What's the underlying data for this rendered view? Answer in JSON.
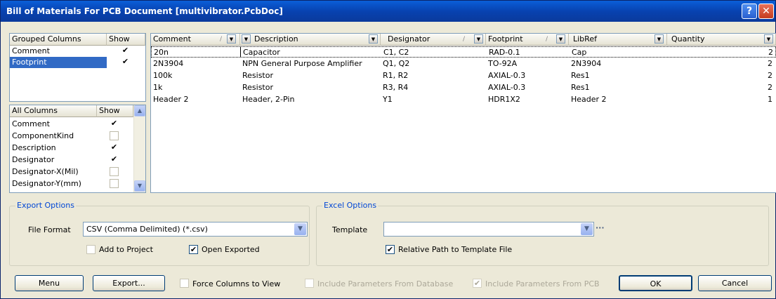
{
  "window": {
    "title": "Bill of Materials For PCB Document [multivibrator.PcbDoc]",
    "help_glyph": "?",
    "close_glyph": "✕"
  },
  "grouped": {
    "header_col": "Grouped Columns",
    "header_show": "Show",
    "items": [
      {
        "label": "Comment",
        "show": "✔"
      },
      {
        "label": "Footprint",
        "show": "✔"
      }
    ]
  },
  "all_columns": {
    "header_col": "All Columns",
    "header_show": "Show",
    "items": [
      {
        "label": "Comment",
        "show": "✔"
      },
      {
        "label": "ComponentKind",
        "show": ""
      },
      {
        "label": "Description",
        "show": "✔"
      },
      {
        "label": "Designator",
        "show": "✔"
      },
      {
        "label": "Designator-X(Mil)",
        "show": ""
      },
      {
        "label": "Designator-Y(mm)",
        "show": ""
      }
    ],
    "scroll_up": "▲",
    "scroll_down": "▼"
  },
  "grid": {
    "columns": [
      {
        "label": "Comment",
        "sort": "/",
        "drop": "▼"
      },
      {
        "label": "Description",
        "sort": "",
        "drop": "▼"
      },
      {
        "label": "Designator",
        "sort": "/",
        "drop": "▼"
      },
      {
        "label": "Footprint",
        "sort": "/",
        "drop": "▼"
      },
      {
        "label": "LibRef",
        "sort": "",
        "drop": "▼"
      },
      {
        "label": "Quantity",
        "sort": "",
        "drop": "▼"
      }
    ],
    "rows": [
      [
        "20n",
        "Capacitor",
        "C1, C2",
        "RAD-0.1",
        "Cap",
        "2"
      ],
      [
        "2N3904",
        "NPN General Purpose Amplifier",
        "Q1, Q2",
        "TO-92A",
        "2N3904",
        "2"
      ],
      [
        "100k",
        "Resistor",
        "R1, R2",
        "AXIAL-0.3",
        "Res1",
        "2"
      ],
      [
        "1k",
        "Resistor",
        "R3, R4",
        "AXIAL-0.3",
        "Res1",
        "2"
      ],
      [
        "Header 2",
        "Header, 2-Pin",
        "Y1",
        "HDR1X2",
        "Header 2",
        "1"
      ]
    ]
  },
  "export_options": {
    "legend": "Export Options",
    "file_format_label": "File Format",
    "file_format_value": "CSV (Comma Delimited) (*.csv)",
    "add_to_project": "Add to Project",
    "open_exported": "Open Exported",
    "combo_arrow": "▼",
    "check_glyph": "✔"
  },
  "excel_options": {
    "legend": "Excel Options",
    "template_label": "Template",
    "template_value": "",
    "browse": "···",
    "relative_path": "Relative Path to Template File",
    "combo_arrow": "▼",
    "check_glyph": "✔"
  },
  "buttons": {
    "menu": "Menu",
    "export": "Export...",
    "force_columns": "Force Columns to View",
    "include_db": "Include Parameters From Database",
    "include_pcb": "Include Parameters From PCB",
    "ok": "OK",
    "cancel": "Cancel",
    "check_glyph": "✔"
  }
}
